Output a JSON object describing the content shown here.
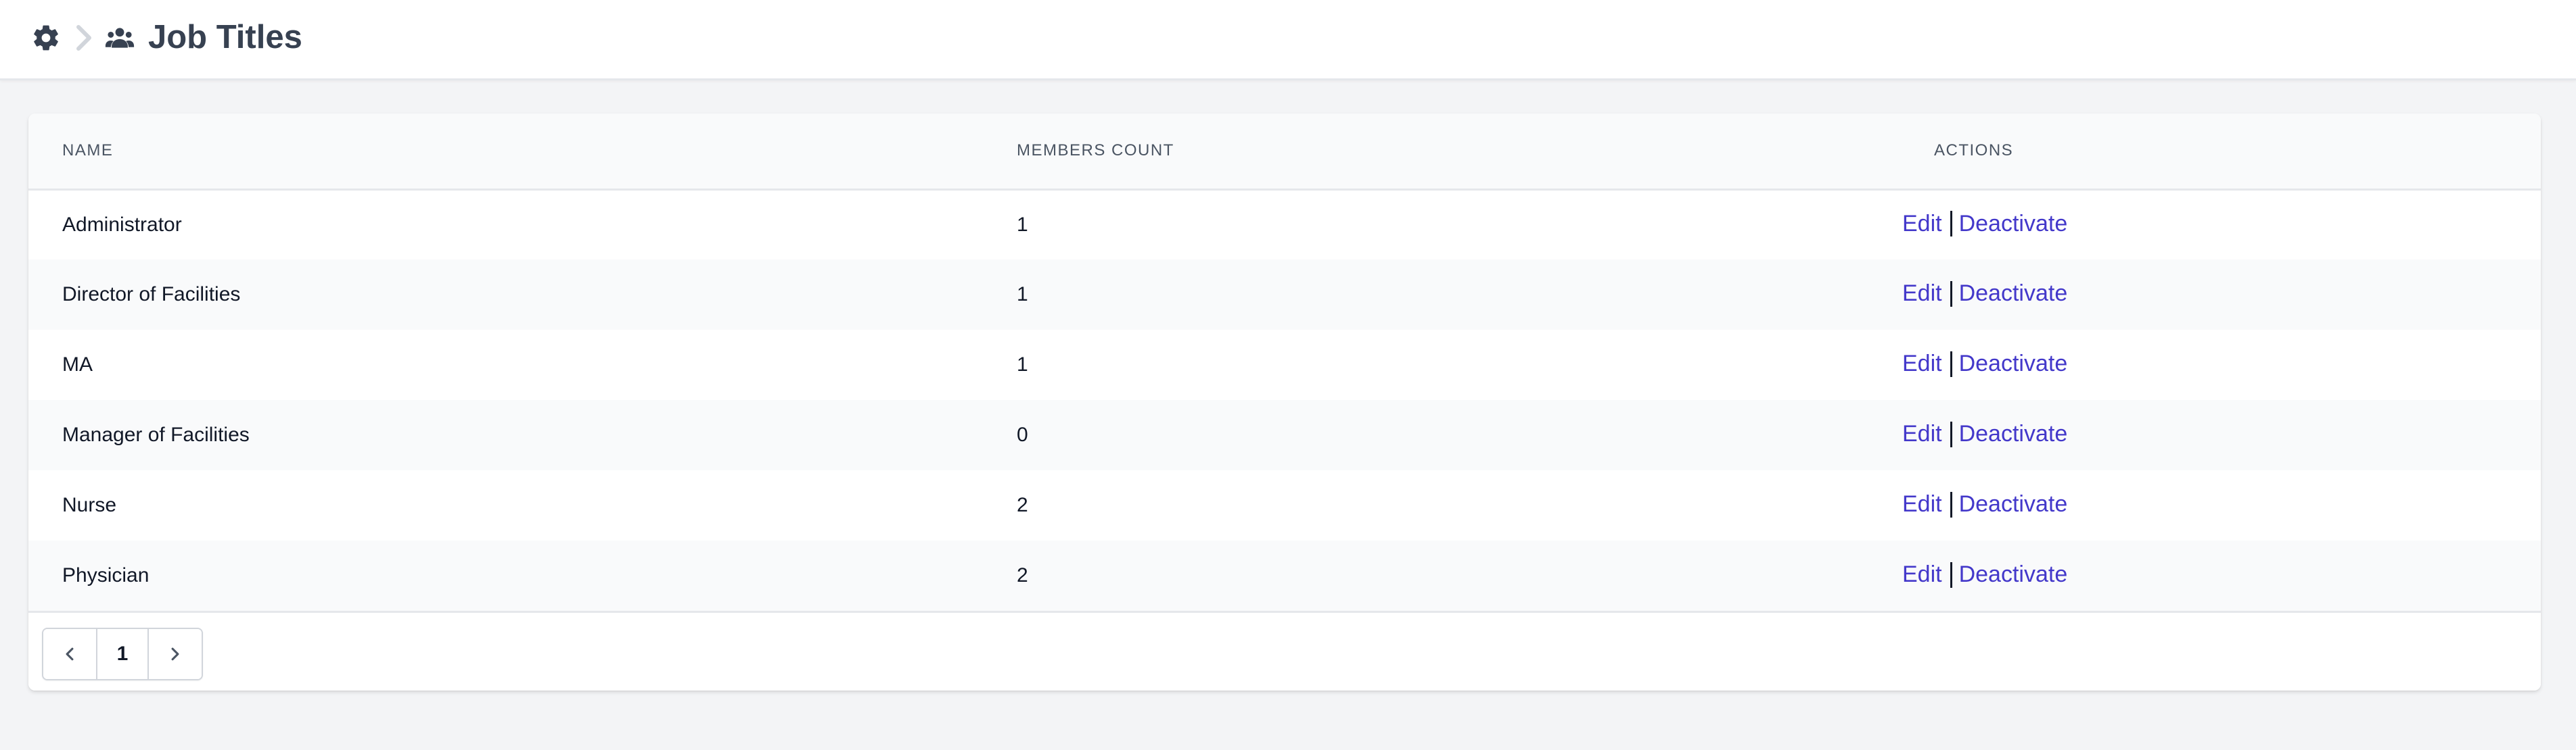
{
  "header": {
    "breadcrumb": [
      {
        "icon": "gear-icon"
      },
      {
        "icon": "users-icon",
        "label": "Job Titles"
      }
    ],
    "title": "Job Titles"
  },
  "table": {
    "columns": {
      "name": "NAME",
      "members_count": "MEMBERS COUNT",
      "actions": "ACTIONS"
    },
    "rows": [
      {
        "name": "Administrator",
        "members_count": "1",
        "edit": "Edit",
        "deactivate": "Deactivate"
      },
      {
        "name": "Director of Facilities",
        "members_count": "1",
        "edit": "Edit",
        "deactivate": "Deactivate"
      },
      {
        "name": "MA",
        "members_count": "1",
        "edit": "Edit",
        "deactivate": "Deactivate"
      },
      {
        "name": "Manager of Facilities",
        "members_count": "0",
        "edit": "Edit",
        "deactivate": "Deactivate"
      },
      {
        "name": "Nurse",
        "members_count": "2",
        "edit": "Edit",
        "deactivate": "Deactivate"
      },
      {
        "name": "Physician",
        "members_count": "2",
        "edit": "Edit",
        "deactivate": "Deactivate"
      }
    ]
  },
  "pagination": {
    "current_page": "1",
    "prev_icon": "chevron-left-icon",
    "next_icon": "chevron-right-icon"
  },
  "colors": {
    "link": "#4338ca",
    "background": "#f3f4f6",
    "title": "#374151"
  }
}
